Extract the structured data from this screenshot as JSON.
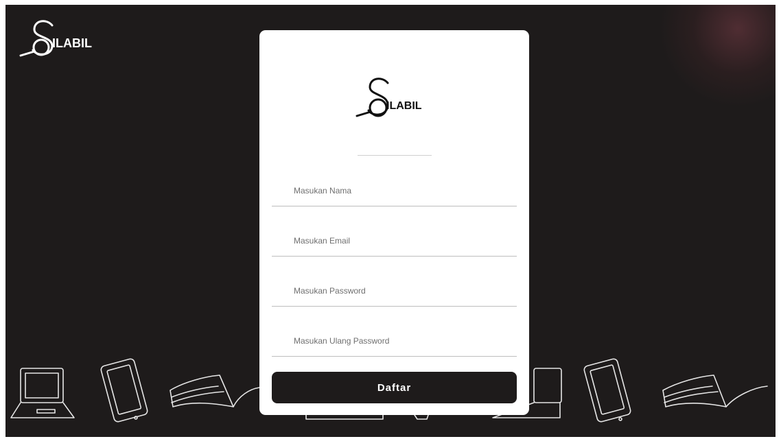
{
  "brand": {
    "logo_text": "ILABIL"
  },
  "form": {
    "fields": [
      {
        "placeholder": "Masukan Nama"
      },
      {
        "placeholder": "Masukan Email"
      },
      {
        "placeholder": "Masukan Password"
      },
      {
        "placeholder": "Masukan Ulang Password"
      }
    ],
    "submit_label": "Daftar"
  },
  "colors": {
    "background": "#1e1b1b",
    "card": "#ffffff",
    "button": "#1e1b1b",
    "button_text": "#ffffff"
  }
}
